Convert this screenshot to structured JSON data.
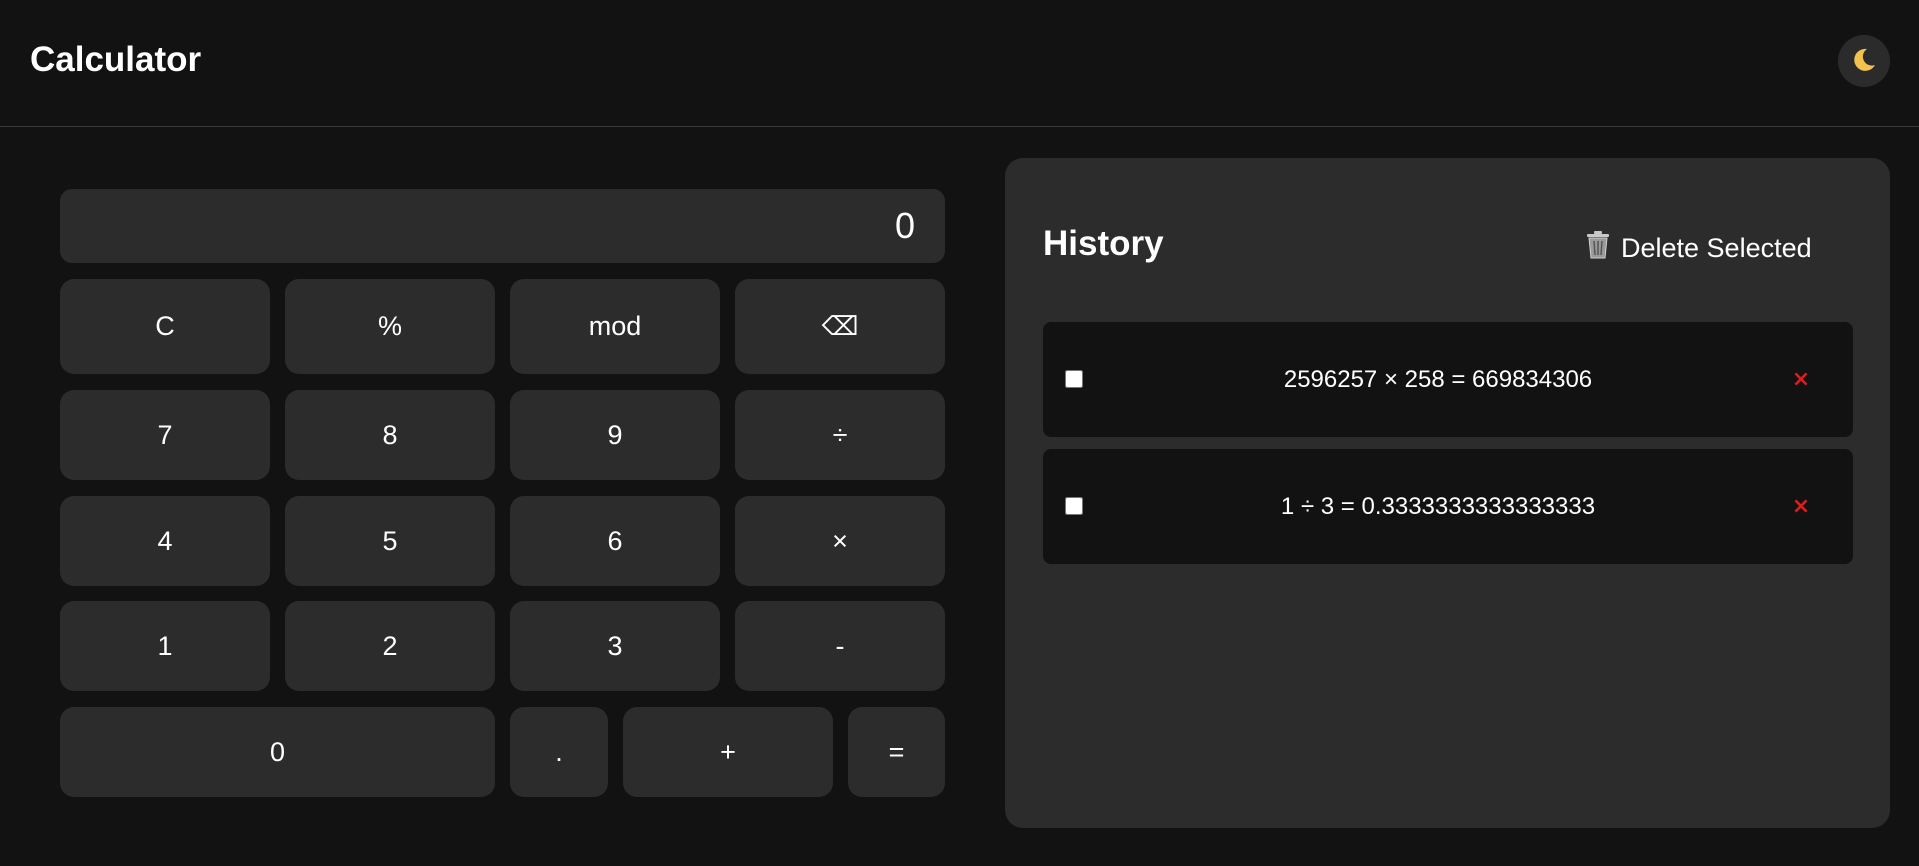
{
  "app": {
    "title": "Calculator"
  },
  "theme": {
    "toggle_icon": "moon-icon"
  },
  "display": {
    "value": "0"
  },
  "keys": {
    "clear": "C",
    "percent": "%",
    "mod": "mod",
    "backspace": "⌫",
    "seven": "7",
    "eight": "8",
    "nine": "9",
    "divide": "÷",
    "four": "4",
    "five": "5",
    "six": "6",
    "multiply": "×",
    "one": "1",
    "two": "2",
    "three": "3",
    "minus": "-",
    "zero": "0",
    "decimal": ".",
    "plus": "+",
    "equals": "="
  },
  "history": {
    "title": "History",
    "delete_selected_label": "Delete Selected",
    "delete_selected_icon": "trash-icon",
    "items": [
      {
        "expression": "2596257 × 258 = 669834306",
        "checked": false
      },
      {
        "expression": "1 ÷ 3 = 0.3333333333333333",
        "checked": false
      }
    ],
    "remove_symbol": "×"
  },
  "colors": {
    "background": "#121212",
    "surface": "#2c2c2c",
    "remove": "#e01c1c",
    "text": "#ffffff"
  }
}
